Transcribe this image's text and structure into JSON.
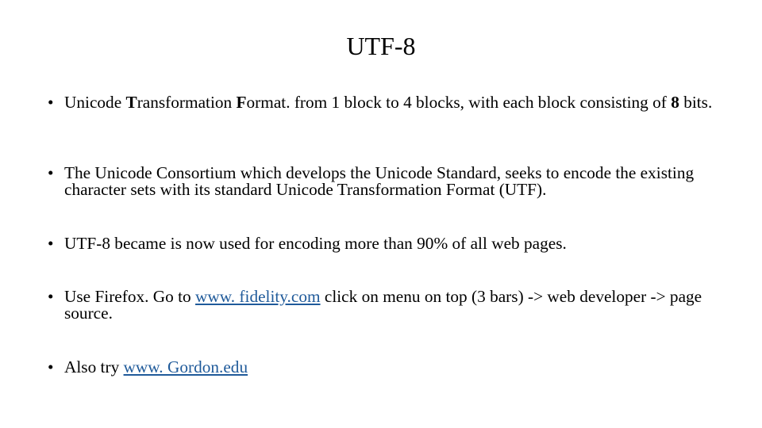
{
  "slide": {
    "title": "UTF-8",
    "bullet_char": "•",
    "bullets": [
      {
        "parts": [
          "Unicode ",
          "T",
          "ransformation ",
          "F",
          "ormat. from 1 block  to 4 blocks, with each block consisting of ",
          "8",
          " bits."
        ]
      },
      {
        "text": "The Unicode Consortium which develops the Unicode Standard, seeks to  encode the existing character sets with its standard Unicode Transformation Format (UTF)."
      },
      {
        "text": "UTF-8 became is now used for encoding more than 90% of all web pages."
      },
      {
        "before": "Use Firefox. Go to ",
        "link": "www. fidelity.com",
        "after": " click on menu on top (3 bars) -> web developer -> page source."
      },
      {
        "before": "Also try ",
        "link": "www. Gordon.edu"
      }
    ],
    "link_color": "#1f5a9a"
  }
}
